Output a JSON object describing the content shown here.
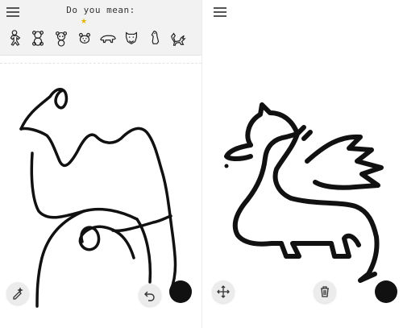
{
  "left_panel": {
    "header": {
      "menu_icon": "hamburger-icon",
      "prompt": "Do you mean:"
    },
    "suggestions": [
      {
        "name": "gingerbread-man-icon",
        "selected": false
      },
      {
        "name": "teddy-bear-icon",
        "selected": false
      },
      {
        "name": "panda-icon",
        "selected": false
      },
      {
        "name": "polar-bear-face-icon",
        "selected": true
      },
      {
        "name": "polar-bear-icon",
        "selected": false
      },
      {
        "name": "lion-face-icon",
        "selected": false
      },
      {
        "name": "penguin-icon",
        "selected": false
      },
      {
        "name": "dragon-icon",
        "selected": false
      }
    ],
    "tools": {
      "magic_pen": "magic-pen-icon",
      "undo": "undo-icon",
      "brush_color": "#111111"
    },
    "drawing": "camel-doodle"
  },
  "right_panel": {
    "header": {
      "menu_icon": "hamburger-icon"
    },
    "tools": {
      "move": "move-icon",
      "delete": "trash-icon",
      "brush_color": "#111111"
    },
    "drawing": "dragon-clipart"
  }
}
